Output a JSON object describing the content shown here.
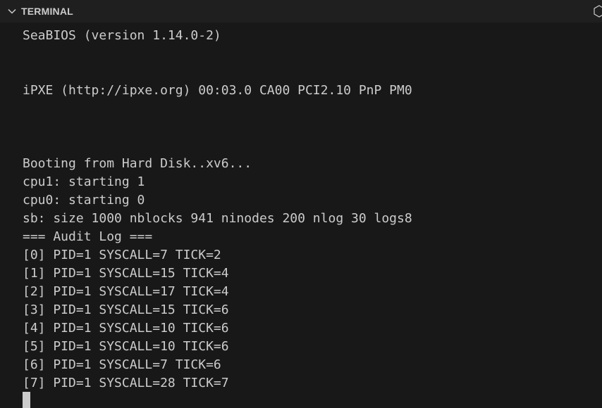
{
  "panel": {
    "title": "TERMINAL",
    "collapse_icon": "chevron-down-icon",
    "action_icon": "hexagon-icon"
  },
  "terminal": {
    "lines": [
      "SeaBIOS (version 1.14.0-2)",
      "iPXE (http://ipxe.org) 00:03.0 CA00 PCI2.10 PnP PM0",
      "Booting from Hard Disk..xv6...",
      "cpu1: starting 1",
      "cpu0: starting 0",
      "sb: size 1000 nblocks 941 ninodes 200 nlog 30 logs8",
      "=== Audit Log ===",
      "[0] PID=1 SYSCALL=7 TICK=2",
      "[1] PID=1 SYSCALL=15 TICK=4",
      "[2] PID=1 SYSCALL=17 TICK=4",
      "[3] PID=1 SYSCALL=15 TICK=6",
      "[4] PID=1 SYSCALL=10 TICK=6",
      "[5] PID=1 SYSCALL=10 TICK=6",
      "[6] PID=1 SYSCALL=7 TICK=6",
      "[7] PID=1 SYSCALL=28 TICK=7"
    ]
  },
  "colors": {
    "background": "#181818",
    "header_background": "#1f1f1f",
    "text": "#cccccc"
  }
}
